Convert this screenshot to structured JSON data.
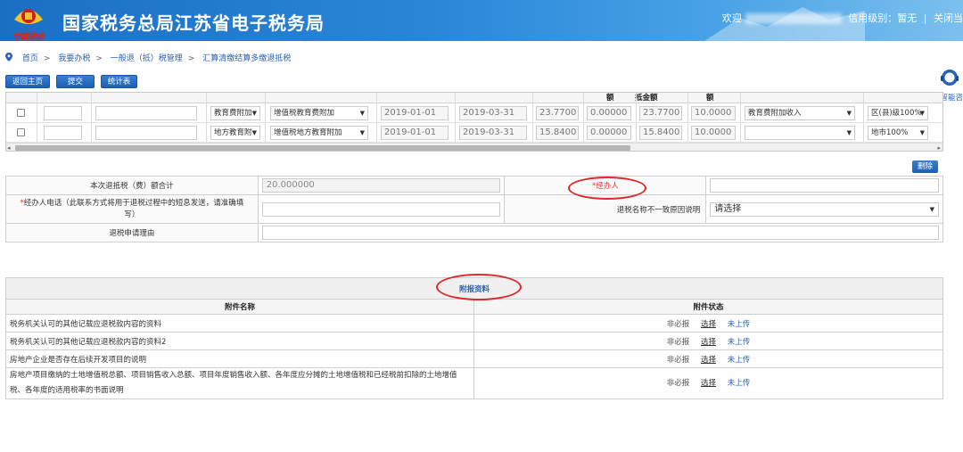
{
  "header": {
    "slogan": "中国税务",
    "title": "国家税务总局江苏省电子税务局",
    "welcome": "欢迎",
    "credit": "信用级别：暂无",
    "divider": "|",
    "close": "关闭当"
  },
  "breadcrumb": [
    "首页",
    "我要办税",
    "一般退（抵）税管理",
    "汇算清缴结算多缴退抵税"
  ],
  "toolbar": {
    "back": "返回主页",
    "submit": "提交",
    "stats": "统计表"
  },
  "help_label": "智能咨",
  "grid": {
    "headers": [
      "额",
      "抵金额",
      "额"
    ],
    "rows": [
      {
        "tax_type": "教育费附加",
        "tax_item": "增值税教育费附加",
        "start": "2019-01-01",
        "end": "2019-03-31",
        "amount": "23.7700",
        "zero": "0.00000",
        "offset": "23.7700",
        "refund": "10.0000",
        "income_type": "教育费附加收入",
        "level": "区(县)级100%"
      },
      {
        "tax_type": "地方教育附",
        "tax_item": "增值税地方教育附加",
        "start": "2019-01-01",
        "end": "2019-03-31",
        "amount": "15.8400",
        "zero": "0.00000",
        "offset": "15.8400",
        "refund": "10.0000",
        "income_type": "",
        "level": "地市100%"
      }
    ]
  },
  "delete_label": "删除",
  "form": {
    "total_label": "本次退抵税（费）额合计",
    "total_value": "20.000000",
    "agent_label": "*经办人",
    "phone_label_req": "*",
    "phone_label": "经办人电话（此联系方式将用于退税过程中的短息发送，请准确填写）",
    "mismatch_label": "退税名称不一致原因说明",
    "mismatch_value": "请选择",
    "reason_label": "退税申请理由"
  },
  "attachments": {
    "title": "附报资料",
    "col_name": "附件名称",
    "col_status": "附件状态",
    "rows": [
      {
        "name": "税务机关认可的其他记载应退税款内容的资料",
        "required": "非必报",
        "choose": "选择",
        "state": "未上传"
      },
      {
        "name": "税务机关认可的其他记载应退税款内容的资料2",
        "required": "非必报",
        "choose": "选择",
        "state": "未上传"
      },
      {
        "name": "房地产企业是否存在后续开发项目的说明",
        "required": "非必报",
        "choose": "选择",
        "state": "未上传"
      },
      {
        "name": "房地产项目缴纳的土地增值税总额、项目销售收入总额、项目年度销售收入额、各年度应分摊的土地增值税和已经税前扣除的土地增值税、各年度的适用税率的书面说明",
        "required": "非必报",
        "choose": "选择",
        "state": "未上传"
      }
    ]
  },
  "colors": {
    "header": "#1a6fc4",
    "button": "#1c5fb3",
    "link": "#2b62b5",
    "annotation": "#e02828"
  }
}
